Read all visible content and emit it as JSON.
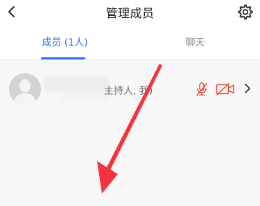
{
  "header": {
    "title": "管理成员",
    "back_icon": "chevron-left-icon",
    "settings_icon": "gear-icon"
  },
  "tabs": [
    {
      "label": "成员 (1人)",
      "active": true
    },
    {
      "label": "聊天",
      "active": false
    }
  ],
  "members": [
    {
      "role_suffix": "主持人, 我)",
      "avatar_icon": "default-avatar-icon",
      "mic_icon": "microphone-muted-icon",
      "mic_status": "muted",
      "camera_icon": "camera-off-icon",
      "camera_status": "off"
    }
  ],
  "colors": {
    "accent": "#2d66f5",
    "muted_red": "#e8533f"
  },
  "annotation": {
    "type": "red-arrow",
    "color": "#f4343c"
  }
}
